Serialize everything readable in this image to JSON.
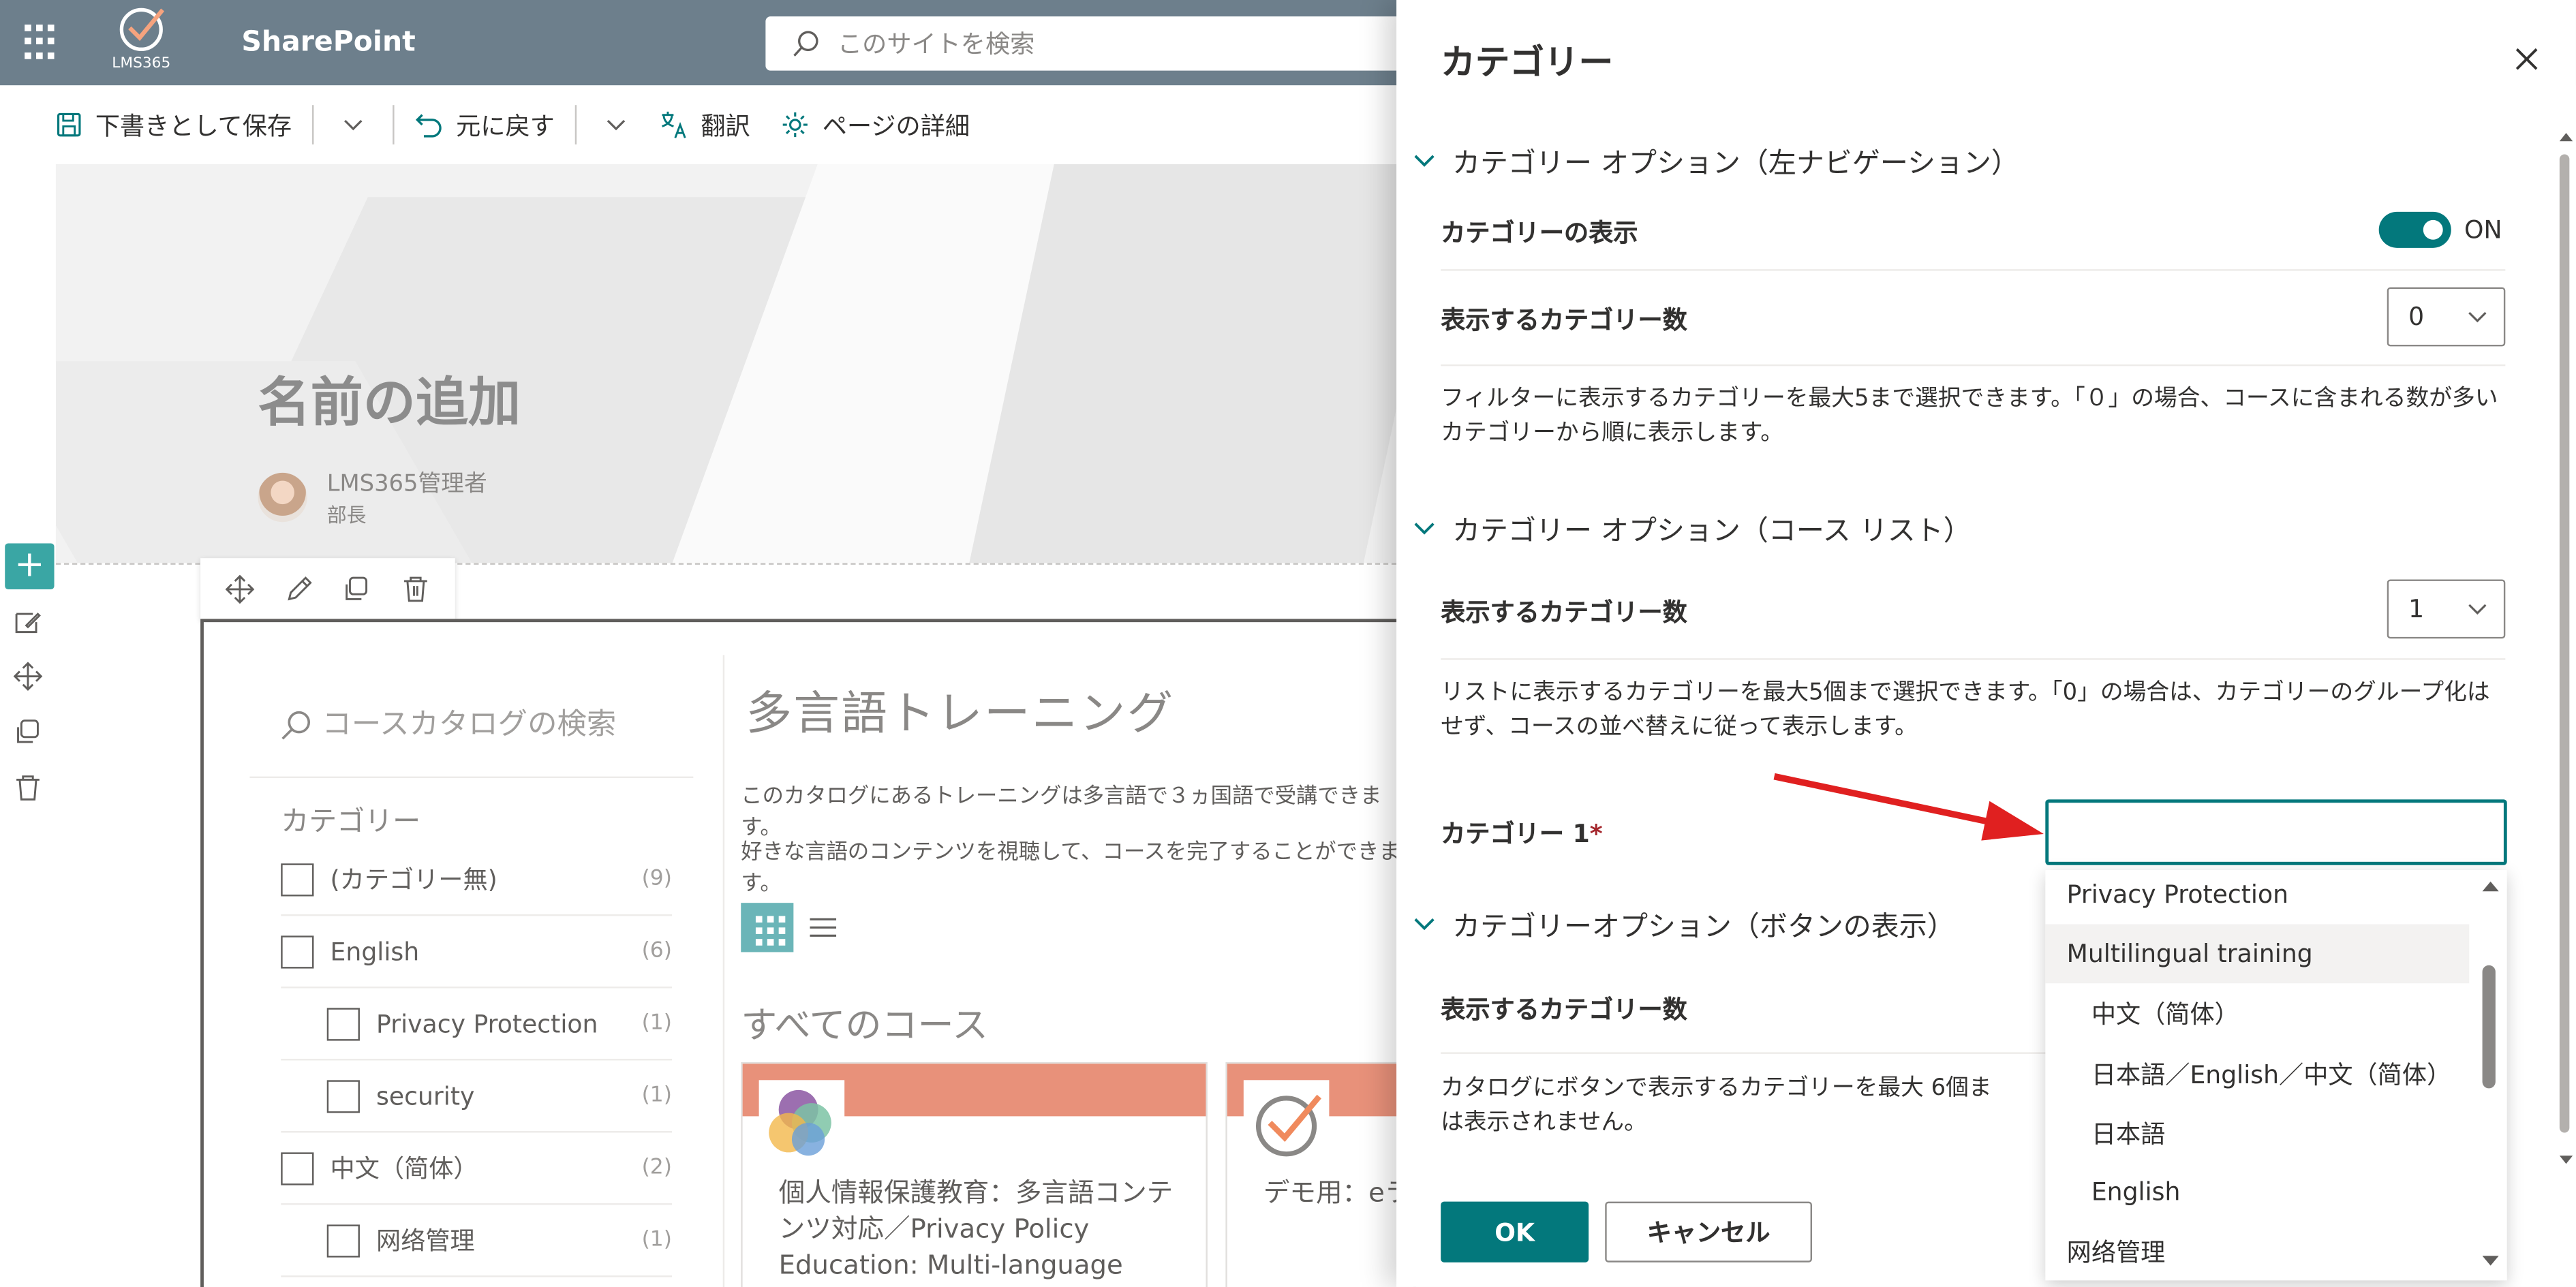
{
  "suite": {
    "logo_text": "LMS365",
    "app_name": "SharePoint",
    "search_placeholder": "このサイトを検索"
  },
  "commands": {
    "save_draft": "下書きとして保存",
    "undo": "元に戻す",
    "translate": "翻訳",
    "page_details": "ページの詳細"
  },
  "hero": {
    "title": "名前の追加",
    "author_name": "LMS365管理者",
    "author_role": "部長"
  },
  "catalog": {
    "search_placeholder": "コースカタログの検索",
    "category_heading": "カテゴリー",
    "categories": [
      {
        "label": "(カテゴリー無)",
        "count": "(9)"
      },
      {
        "label": "English",
        "count": "(6)"
      },
      {
        "label": "Privacy Protection",
        "count": "(1)"
      },
      {
        "label": "security",
        "count": "(1)"
      },
      {
        "label": "中文（简体）",
        "count": "(2)"
      },
      {
        "label": "网络管理",
        "count": "(1)"
      }
    ],
    "title": "多言語トレーニング",
    "desc1": "このカタログにあるトレーニングは多言語で３ヵ国語で受講できます。",
    "desc2": "好きな言語のコンテンツを視聴して、コースを完了することができます。",
    "all_courses": "すべてのコース",
    "cards": [
      {
        "title": "個人情報保護教育：多言語コンテンツ対応／Privacy Policy Education: Multi-language"
      },
      {
        "title": "デモ用：eラ"
      }
    ]
  },
  "panel": {
    "title": "カテゴリー",
    "section1": "カテゴリー オプション（左ナビゲーション）",
    "show_categories_label": "カテゴリーの表示",
    "toggle_state": "ON",
    "count_label": "表示するカテゴリー数",
    "count_value_1": "0",
    "help1": "フィルターに表示するカテゴリーを最大5まで選択できます。「０」の場合、コースに含まれる数が多いカテゴリーから順に表示します。",
    "section2": "カテゴリー オプション（コース リスト）",
    "count_label_2": "表示するカテゴリー数",
    "count_value_2": "1",
    "help2": "リストに表示するカテゴリーを最大5個まで選択できます。「0」の場合は、カテゴリーのグループ化はせず、コースの並べ替えに従って表示します。",
    "category1_label": "カテゴリー 1",
    "required_mark": "*",
    "section3": "カテゴリーオプション（ボタンの表示）",
    "count_label_3": "表示するカテゴリー数",
    "help3_line1": "カタログにボタンで表示するカテゴリーを最大 6個ま",
    "help3_line2": "は表示されません。",
    "ok": "OK",
    "cancel": "キャンセル",
    "dropdown_options": [
      "Privacy Protection",
      "Multilingual training",
      "中文（简体）",
      "日本語／English／中文（简体）",
      "日本語",
      "English",
      "网络管理"
    ]
  },
  "colors": {
    "accent": "#03787c",
    "suite_bar": "#6d7f8c",
    "card_band": "#e8917a",
    "arrow": "#e02020"
  }
}
